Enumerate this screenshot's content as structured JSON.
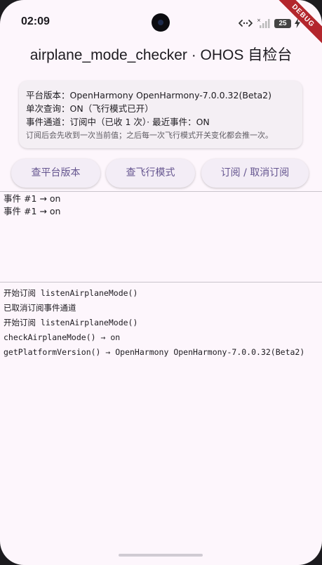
{
  "status_bar": {
    "time": "02:09",
    "battery_level": "25",
    "icons": [
      "data-arrows-icon",
      "signal-icon",
      "battery-icon",
      "charging-icon"
    ]
  },
  "debug_banner": "DEBUG",
  "app_title": "airplane_mode_checker · OHOS 自检台",
  "info": {
    "platform_version": "平台版本：OpenHarmony OpenHarmony-7.0.0.32(Beta2)",
    "single_query": "单次查询：ON（飞行模式已开）",
    "event_channel": "事件通道：订阅中（已收 1 次）· 最近事件：ON",
    "hint": "订阅后会先收到一次当前值；之后每一次飞行模式开关变化都会推一次。"
  },
  "buttons": {
    "check_version": "查平台版本",
    "check_mode": "查飞行模式",
    "toggle_subscribe": "订阅 / 取消订阅"
  },
  "events": [
    "事件 #1 → on",
    "事件 #1 → on"
  ],
  "logs": [
    "开始订阅 listenAirplaneMode()",
    "已取消订阅事件通道",
    "开始订阅 listenAirplaneMode()",
    "checkAirplaneMode() → on",
    "getPlatformVersion() → OpenHarmony OpenHarmony-7.0.0.32(Beta2)"
  ],
  "colors": {
    "background": "#fdf6fc",
    "button_text": "#65558f",
    "debug_ribbon": "#b3262d"
  }
}
